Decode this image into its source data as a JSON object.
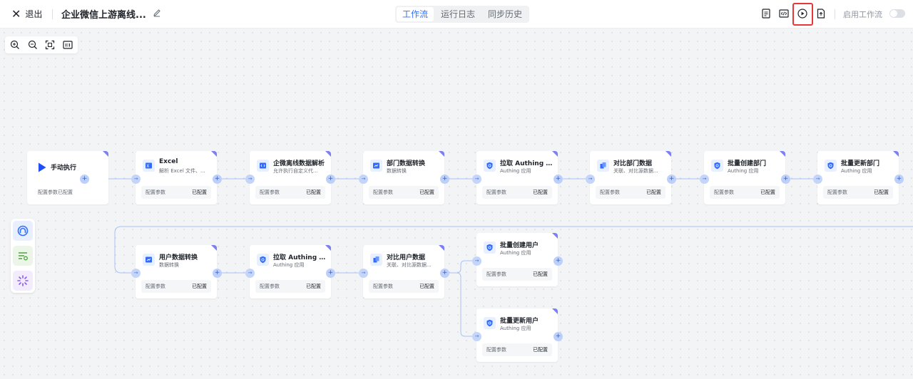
{
  "topbar": {
    "exit_label": "退出",
    "title": "企业微信上游离线...",
    "tabs": [
      {
        "label": "工作流",
        "active": true
      },
      {
        "label": "运行日志",
        "active": false
      },
      {
        "label": "同步历史",
        "active": false
      }
    ],
    "actions": [
      "document-icon",
      "code-icon",
      "play-circle-icon",
      "export-icon"
    ],
    "enable_label": "启用工作流",
    "enabled": false
  },
  "zoom_tools": [
    "zoom-in-icon",
    "zoom-out-icon",
    "fit-view-icon",
    "actual-size-icon"
  ],
  "side_panel": [
    "trigger-icon",
    "list-settings-icon",
    "loading-icon"
  ],
  "colors": {
    "accent": "#3370ff",
    "highlight": "#e53935",
    "node_corner": "#7b7ff0"
  },
  "nodes": {
    "trigger": {
      "title": "手动执行",
      "config_label": "配置参数",
      "status": "已配置"
    },
    "excel": {
      "title": "Excel",
      "subtitle": "解析 Excel 文件、...",
      "config_label": "配置参数",
      "status": "已配置"
    },
    "wecom_parse": {
      "title": "企微离线数据解析",
      "subtitle": "允许执行自定义代...",
      "config_label": "配置参数",
      "status": "已配置"
    },
    "dept_convert": {
      "title": "部门数据转换",
      "subtitle": "数据转换",
      "config_label": "配置参数",
      "status": "已配置"
    },
    "pull_dept": {
      "title": "拉取 Authing 部...",
      "subtitle": "Authing 应用",
      "config_label": "配置参数",
      "status": "已配置"
    },
    "compare_dept": {
      "title": "对比部门数据",
      "subtitle": "关联、对比源数据...",
      "config_label": "配置参数",
      "status": "已配置"
    },
    "batch_create_dept": {
      "title": "批量创建部门",
      "subtitle": "Authing 应用",
      "config_label": "配置参数",
      "status": "已配置"
    },
    "batch_update_dept": {
      "title": "批量更新部门",
      "subtitle": "Authing 应用",
      "config_label": "配置参数",
      "status": "已配置"
    },
    "user_convert": {
      "title": "用户数据转换",
      "subtitle": "数据转换",
      "config_label": "配置参数",
      "status": "已配置"
    },
    "pull_user": {
      "title": "拉取 Authing 用...",
      "subtitle": "Authing 应用",
      "config_label": "配置参数",
      "status": "已配置"
    },
    "compare_user": {
      "title": "对比用户数据",
      "subtitle": "关联、对比源数据...",
      "config_label": "配置参数",
      "status": "已配置"
    },
    "batch_create_user": {
      "title": "批量创建用户",
      "subtitle": "Authing 应用",
      "config_label": "配置参数",
      "status": "已配置"
    },
    "batch_update_user": {
      "title": "批量更新用户",
      "subtitle": "Authing 应用",
      "config_label": "配置参数",
      "status": "已配置"
    }
  }
}
